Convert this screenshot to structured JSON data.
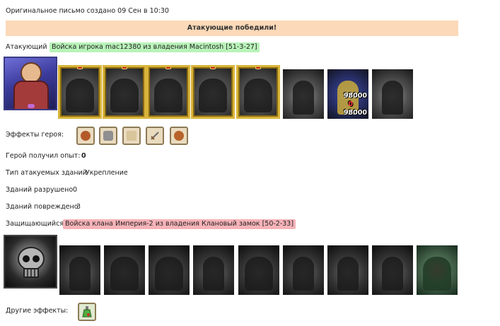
{
  "header": {
    "created_text": "Оригинальное письмо создано 09 Сен в 10:30"
  },
  "result": {
    "banner": "Атакующие победили!"
  },
  "attacker": {
    "label": "Атакующий",
    "tag": "Войска игрока mac12380 из владения Macintosh [51-3-27]",
    "hero_icon": "hero-portrait-icon",
    "units": [
      {
        "icon": "horseman-icon",
        "framed": true
      },
      {
        "icon": "crossbow-cavalry-icon",
        "framed": true
      },
      {
        "icon": "knight-icon",
        "framed": true
      },
      {
        "icon": "griffin-icon",
        "framed": true
      },
      {
        "icon": "archer-icon",
        "framed": true
      },
      {
        "icon": "monk-icon",
        "framed": false
      },
      {
        "icon": "paladin-icon",
        "framed": false,
        "count_top": "98000",
        "count_mid": "0",
        "count_bottom": "98000"
      },
      {
        "icon": "reaper-icon",
        "framed": false
      }
    ]
  },
  "hero_effects": {
    "label": "Эффекты героя:",
    "items": [
      "warrior-head-icon",
      "armor-icon",
      "scroll-icon",
      "sword-icon",
      "shield-icon"
    ]
  },
  "stats": {
    "exp_label": "Герой получил опыт:",
    "exp_value": "0",
    "building_type_label": "Тип атакуемых зданий",
    "building_type_value": "Укрепление",
    "destroyed_label": "Зданий разрушено",
    "destroyed_value": "0",
    "damaged_label": "Зданий повреждено",
    "damaged_value": "3"
  },
  "defender": {
    "label": "Защищающийся",
    "tag": "Войска клана Империя-2 из владения Клановый замок [50-2-33]",
    "hero_icon": "skull-emblem-icon",
    "units": [
      "bone-dragon-icon",
      "ogre-icon",
      "orc-warlord-icon",
      "gargoyle-icon",
      "harpy-icon",
      "cyclops-icon",
      "dark-knight-icon",
      "lich-icon",
      "spider-nest-icon"
    ]
  },
  "other_effects": {
    "label": "Другие эффекты:",
    "items": [
      "potion-icon"
    ]
  },
  "colors": {
    "banner_bg": "#fcd9b8",
    "attacker_tag": "#b9f3b9",
    "defender_tag": "#f6b3b8",
    "frame_gold": "#d9b43a"
  }
}
